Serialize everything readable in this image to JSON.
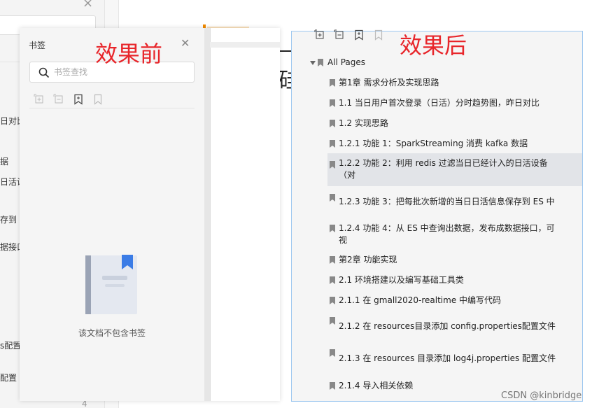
{
  "background_panel": {
    "fragments": [
      "日对比",
      "据",
      "日活设",
      "存到 E",
      "据接口",
      "s配置",
      "配置"
    ],
    "page_number": "4"
  },
  "before_label": "效果前",
  "after_label": "效果后",
  "before_panel": {
    "title": "书签",
    "search_placeholder": "书签查找",
    "empty_text": "该文档不包含书签"
  },
  "after_panel": {
    "root": "All Pages",
    "items": [
      "第1章 需求分析及实现思路",
      "1.1 当日用户首次登录（日活）分时趋势图，昨日对比",
      "1.2 实现思路",
      "1.2.1 功能 1：SparkStreaming 消费 kafka 数据",
      "1.2.2 功能 2：利用 redis 过滤当日已经计入的日活设备（对",
      "1.2.3 功能 3：把每批次新增的当日日活信息保存到 ES 中",
      "1.2.4 功能 4：从 ES 中查询出数据，发布成数据接口，可视",
      "第2章 功能实现",
      "2.1 环境搭建以及编写基础工具类",
      "2.1.1 在 gmall2020-realtime 中编写代码",
      "2.1.2 在 resources目录添加 config.properties配置文件",
      "2.1.3 在 resources 目录添加 log4j.properties 配置文件",
      "2.1.4 导入相关依赖"
    ]
  },
  "watermark": "CSDN @kinbridge"
}
